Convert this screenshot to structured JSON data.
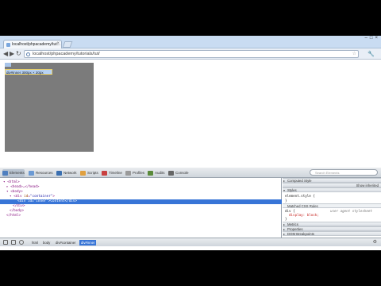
{
  "browser": {
    "tab_title": "localhost/phpacademy/tut...",
    "tab_close": "×",
    "url": "localhost/phpacademy/tutorials/tut/",
    "back": "◀",
    "forward": "▶",
    "reload": "↻",
    "star": "☆",
    "wrench": "🔧",
    "win_min": "–",
    "win_max": "□",
    "win_close": "×"
  },
  "page": {
    "inner_label": "div#inner 300px × 20px"
  },
  "devtools": {
    "tabs": [
      {
        "label": "Elements",
        "color": "#4f7fbf"
      },
      {
        "label": "Resources",
        "color": "#6b9ad4"
      },
      {
        "label": "Network",
        "color": "#3a6fb0"
      },
      {
        "label": "Scripts",
        "color": "#e0a040"
      },
      {
        "label": "Timeline",
        "color": "#c94040"
      },
      {
        "label": "Profiles",
        "color": "#9a9a9a"
      },
      {
        "label": "Audits",
        "color": "#5a8a3a"
      },
      {
        "label": "Console",
        "color": "#666666"
      }
    ],
    "search_placeholder": "Search Elements",
    "dom": [
      {
        "tri": "▾",
        "tag": "<html>"
      },
      {
        "tri": "▸",
        "tag": "<head>…</head>"
      },
      {
        "tri": "▾",
        "tag": "<body>"
      },
      {
        "tri": "▾",
        "tag": "<div ",
        "attr": "id",
        "val": "\"container\"",
        "end": ">"
      },
      {
        "tri": "",
        "tag": "<div ",
        "attr": "id",
        "val": "\"inner\"",
        "end": ">",
        "text": "Content",
        "close": "</div>"
      },
      {
        "tri": "",
        "tag": "</div>"
      },
      {
        "tri": "",
        "tag": "</body>"
      },
      {
        "tri": "",
        "tag": "</html>"
      }
    ],
    "sidebar": {
      "computed": "Computed Style",
      "computed_check": "Show inherited",
      "styles": "Styles",
      "element_style": "element.style {",
      "brace_close": "}",
      "matched_head": "Matched CSS Rules",
      "rule_selector": "div {",
      "rule_source": "user agent stylesheet",
      "rule_prop": "display: block;",
      "metrics": "Metrics",
      "properties": "Properties",
      "dom_bp": "DOM Breakpoints",
      "event_listeners": "Event Listeners"
    },
    "breadcrumbs": [
      "html",
      "body",
      "div#container",
      "div#inner"
    ],
    "gear": "⚙"
  }
}
